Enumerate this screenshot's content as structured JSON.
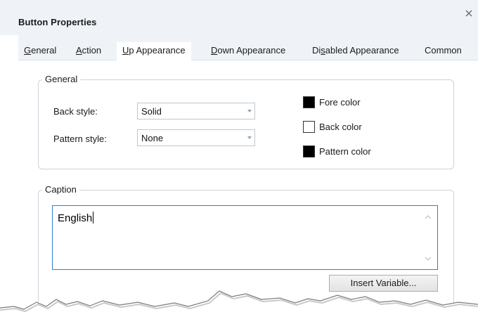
{
  "window": {
    "title": "Button Properties",
    "close_label": "Close"
  },
  "tabs": [
    {
      "pre": "",
      "key": "G",
      "post": "eneral"
    },
    {
      "pre": "",
      "key": "A",
      "post": "ction"
    },
    {
      "pre": "",
      "key": "U",
      "post": "p Appearance",
      "active": true
    },
    {
      "pre": "",
      "key": "D",
      "post": "own Appearance"
    },
    {
      "pre": "Di",
      "key": "s",
      "post": "abled Appearance"
    },
    {
      "pre": "Common",
      "key": "",
      "post": ""
    }
  ],
  "general_group": {
    "title": "General",
    "back_style_label": "Back style:",
    "back_style_value": "Solid",
    "pattern_style_label": "Pattern style:",
    "pattern_style_value": "None",
    "fore_color_label": "Fore color",
    "fore_color": "#000000",
    "back_color_label": "Back color",
    "back_color": "#ffffff",
    "pattern_color_label": "Pattern color",
    "pattern_color": "#000000"
  },
  "caption_group": {
    "title": "Caption",
    "text": "English",
    "insert_variable_label": "Insert Variable..."
  },
  "colors": {
    "title_bar": "#eff3f8",
    "focus_border": "#2f7fd3",
    "group_border": "#cbd3dc"
  }
}
